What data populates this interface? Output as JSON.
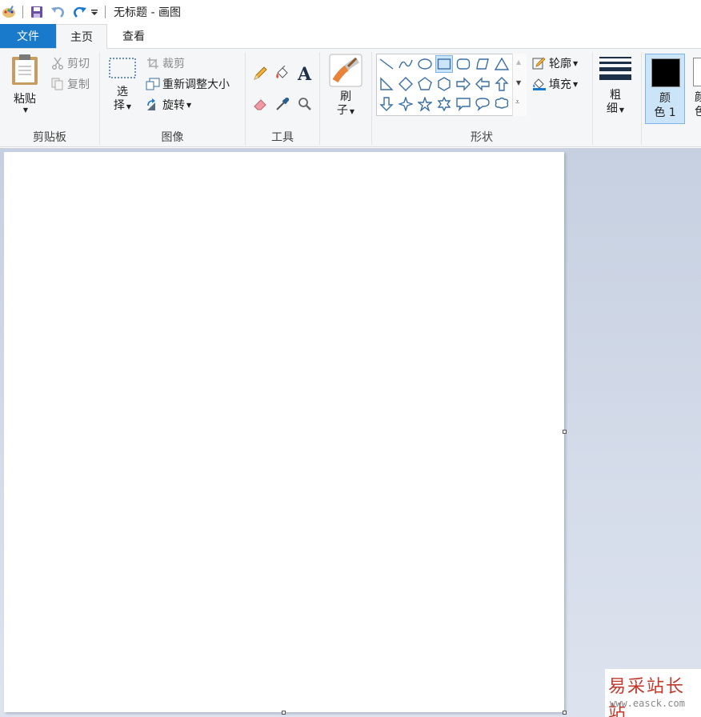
{
  "window": {
    "title": "无标题 - 画图"
  },
  "quick_access": [
    "paint-app-icon",
    "save-icon",
    "undo-icon",
    "redo-icon",
    "customize-dropdown-icon"
  ],
  "tabs": [
    {
      "label": "文件",
      "active": false
    },
    {
      "label": "主页",
      "active": true
    },
    {
      "label": "查看",
      "active": false
    }
  ],
  "ribbon": {
    "clipboard": {
      "label": "剪贴板",
      "paste": "粘贴",
      "cut": "剪切",
      "copy": "复制"
    },
    "image": {
      "label": "图像",
      "select_top": "选",
      "select_bottom": "择",
      "crop": "裁剪",
      "resize": "重新调整大小",
      "rotate": "旋转"
    },
    "tools": {
      "label": "工具"
    },
    "brushes": {
      "top": "刷",
      "bottom": "子"
    },
    "shapes": {
      "label": "形状",
      "outline": "轮廓",
      "fill": "填充"
    },
    "size": {
      "top": "粗",
      "bottom": "细"
    },
    "color1": {
      "top": "颜",
      "bottom": "色 1",
      "value": "#000000"
    },
    "color2": {
      "top": "颜",
      "bottom": "色"
    }
  },
  "watermark": {
    "cn": "易采站长站",
    "en": "www.easck.com"
  },
  "colors": {
    "file_tab": "#1979ca",
    "ribbon_bg": "#f5f6f7",
    "workspace": "#c6d0e0",
    "accent": "#1979ca"
  }
}
